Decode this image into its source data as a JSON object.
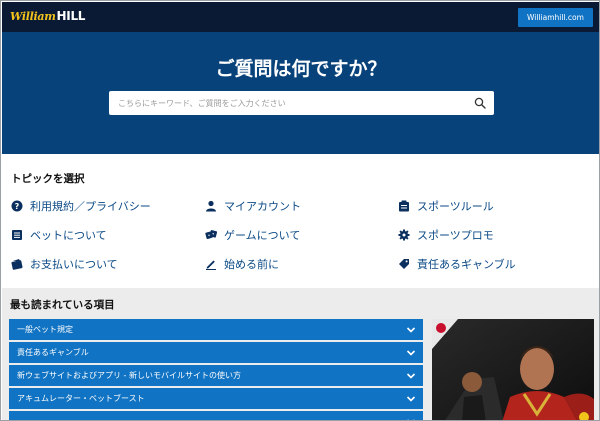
{
  "header": {
    "logo_script": "William",
    "logo_bold": "HILL",
    "site_button": "Williamhill.com"
  },
  "hero": {
    "title": "ご質問は何ですか？",
    "search_placeholder": "こちらにキーワード、ご質問をご入力ください"
  },
  "topics": {
    "title": "トピックを選択",
    "items": [
      {
        "label": "利用規約／プライバシー",
        "icon": "question-circle-icon"
      },
      {
        "label": "マイアカウント",
        "icon": "user-icon"
      },
      {
        "label": "スポーツルール",
        "icon": "clipboard-icon"
      },
      {
        "label": "ベットについて",
        "icon": "list-icon"
      },
      {
        "label": "ゲームについて",
        "icon": "dice-icon"
      },
      {
        "label": "スポーツプロモ",
        "icon": "gear-icon"
      },
      {
        "label": "お支払いについて",
        "icon": "wallet-icon"
      },
      {
        "label": "始める前に",
        "icon": "pen-icon"
      },
      {
        "label": "責任あるギャンブル",
        "icon": "tag-icon"
      }
    ]
  },
  "popular": {
    "title": "最も読まれている項目",
    "items": [
      "一般ベット規定",
      "責任あるギャンブル",
      "新ウェブサイトおよびアプリ - 新しいモバイルサイトの使い方",
      "アキュムレーター・ベットブースト",
      ""
    ]
  },
  "colors": {
    "topbar": "#0a1a34",
    "hero": "#08427a",
    "accent": "#1173c3",
    "link": "#0b4a86",
    "section_gray": "#ececec"
  }
}
